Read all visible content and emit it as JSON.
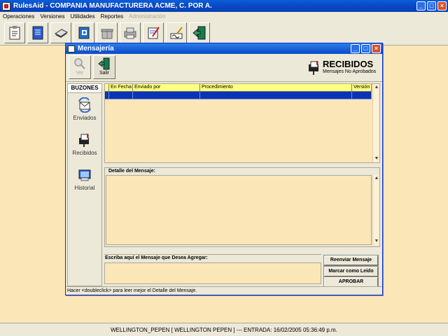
{
  "app": {
    "title": "RulesAid  -  COMPANIA MANUFACTURERA ACME, C. POR A."
  },
  "menu": [
    {
      "label": "Operaciones",
      "enabled": true
    },
    {
      "label": "Versiones",
      "enabled": true
    },
    {
      "label": "Utilidades",
      "enabled": true
    },
    {
      "label": "Reportes",
      "enabled": true
    },
    {
      "label": "Administración",
      "enabled": false
    }
  ],
  "toolbar_icons": [
    "clipboard-icon",
    "blue-document-icon",
    "disk-icon",
    "message-book-icon",
    "gift-icon",
    "printer-icon",
    "edit-form-icon",
    "signature-icon",
    "exit-door-icon"
  ],
  "child": {
    "title": "Mensajería",
    "btn_ver": "Ver",
    "btn_salir": "Salir",
    "heading": "RECIBIDOS",
    "subheading": "Mensajes No Aprobados",
    "sidebar": {
      "header": "BUZONES",
      "items": [
        {
          "label": "Enviados",
          "icon": "envelope-arrows-icon"
        },
        {
          "label": "Recibidos",
          "icon": "mailbox-icon"
        },
        {
          "label": "Historial",
          "icon": "history-icon"
        }
      ]
    },
    "grid": {
      "columns": [
        "",
        "En Fecha",
        "Enviado por",
        "Procedimiento",
        "Versión"
      ],
      "rows": []
    },
    "detail_label": "Detalle del Mensaje:",
    "write_label": "Escriba aquí el Mensaje que Desea Agregar:",
    "actions": {
      "reenviar": "Reenviar Mensaje",
      "marcar": "Marcar como Leído",
      "aprobar": "APROBAR"
    },
    "status": "Hacer <doubleclick> para leer mejor el Detalle del Mensaje."
  },
  "statusbar": "WELLINGTON_PEPEN [ WELLINGTON PEPEN ] --- ENTRADA: 16/02/2005 05:36:49 p.m.",
  "colors": {
    "background": "#fbe6b8",
    "titlebar": "#0a4bc8",
    "grid_header": "#ffff80",
    "selected_row": "#0a34b3"
  }
}
